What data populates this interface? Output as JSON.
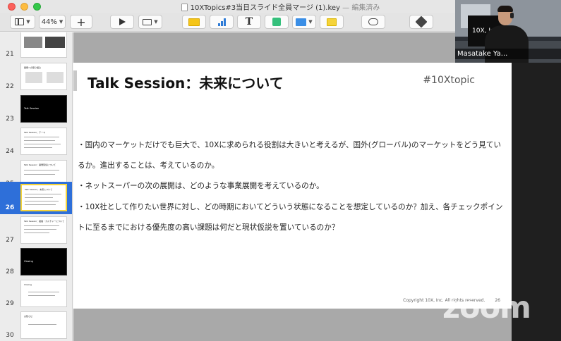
{
  "window": {
    "title": "10XTopics#3当日スライド全員マージ (1).key",
    "status": "— 編集済み"
  },
  "toolbar": {
    "zoom_level": "44%",
    "add_slide_label": "+",
    "icons": [
      "view-icon",
      "add-icon",
      "play-icon",
      "keynote-live-icon",
      "table-icon",
      "chart-icon",
      "text-icon",
      "shape-icon",
      "media-icon",
      "comment-icon",
      "collaborate-icon",
      "format-icon"
    ]
  },
  "navigator": {
    "selected_slide": "26",
    "slides": [
      {
        "number": "21",
        "style": "images",
        "text": ""
      },
      {
        "number": "22",
        "style": "light",
        "text": "開発への取り組み"
      },
      {
        "number": "23",
        "style": "dark",
        "text": "Talk Session"
      },
      {
        "number": "24",
        "style": "light",
        "text": "Talk Session：テーマ"
      },
      {
        "number": "25",
        "style": "light",
        "text": "Talk Session：開発環境について"
      },
      {
        "number": "26",
        "style": "light",
        "text": "Talk Session：未来について"
      },
      {
        "number": "27",
        "style": "light",
        "text": "Talk Session：組織・カルチャーについて"
      },
      {
        "number": "28",
        "style": "dark",
        "text": "Closing"
      },
      {
        "number": "29",
        "style": "light",
        "text": "Closing"
      },
      {
        "number": "30",
        "style": "light",
        "text": "お知らせ"
      }
    ]
  },
  "slide": {
    "title": "Talk Session：未来について",
    "hashtag": "#10Xtopic",
    "bullets": [
      "・国内のマーケットだけでも巨大で、10Xに求められる役割は大きいと考えるが、国外(グローバル)のマーケットをどう見ているか。進出することは、考えているのか。",
      "・ネットスーパーの次の展開は、どのような事業展開を考えているのか。",
      "・10X社として作りたい世界に対し、どの時期においてどういう状態になることを想定しているのか？加え、各チェックポイントに至るまでにおける優先度の高い課題は何だと現状仮説を置いているのか？"
    ],
    "footer": "Copyright 10X, Inc. All rights reserved.",
    "page_number": "26"
  },
  "webcam": {
    "participant_name": "Masatake Ya...",
    "background_text": "10X, In"
  },
  "watermark": {
    "text": "zoom"
  }
}
